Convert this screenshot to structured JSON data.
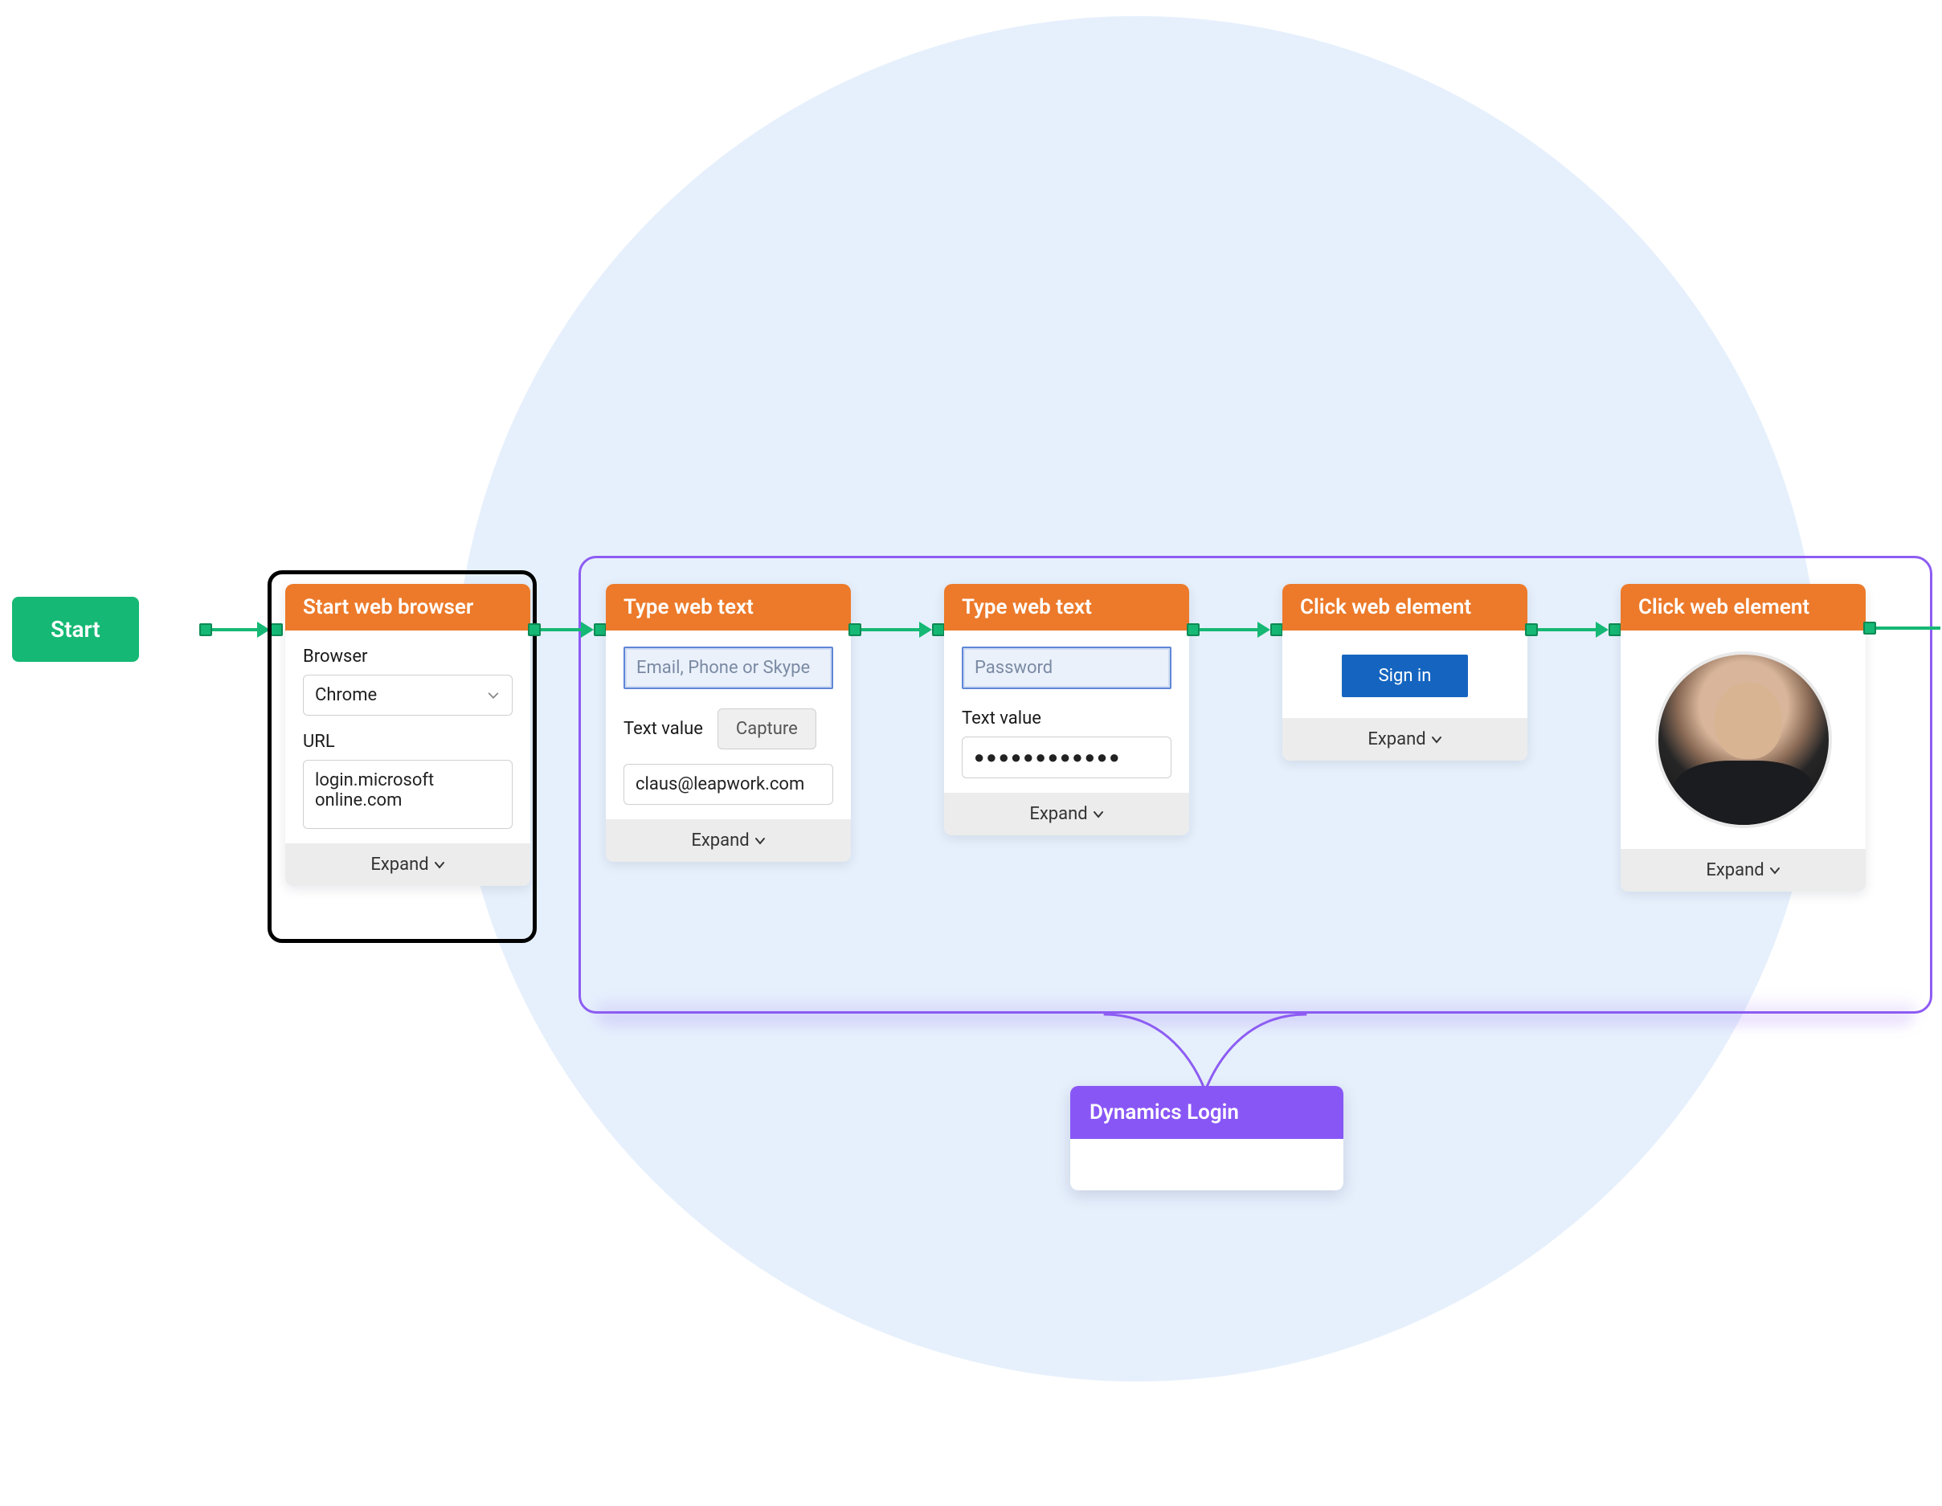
{
  "start": {
    "label": "Start"
  },
  "nodes": {
    "browser": {
      "title": "Start web browser",
      "browser_label": "Browser",
      "browser_value": "Chrome",
      "url_label": "URL",
      "url_value": "login.microsoft\nonline.com",
      "expand": "Expand"
    },
    "type1": {
      "title": "Type web text",
      "placeholder": "Email, Phone or Skype",
      "textvalue_label": "Text value",
      "capture": "Capture",
      "value": "claus@leapwork.com",
      "expand": "Expand"
    },
    "type2": {
      "title": "Type web text",
      "placeholder": "Password",
      "textvalue_label": "Text value",
      "masked_value": "●●●●●●●●●●●●",
      "expand": "Expand"
    },
    "click1": {
      "title": "Click web element",
      "button_label": "Sign in",
      "expand": "Expand"
    },
    "click2": {
      "title": "Click web element",
      "expand": "Expand"
    }
  },
  "group_label": "Dynamics Login",
  "colors": {
    "green": "#15b874",
    "orange": "#ec7a2a",
    "purple": "#8956f6",
    "accent_blue": "#1565c0",
    "bg_circle": "#e6f0fc"
  }
}
